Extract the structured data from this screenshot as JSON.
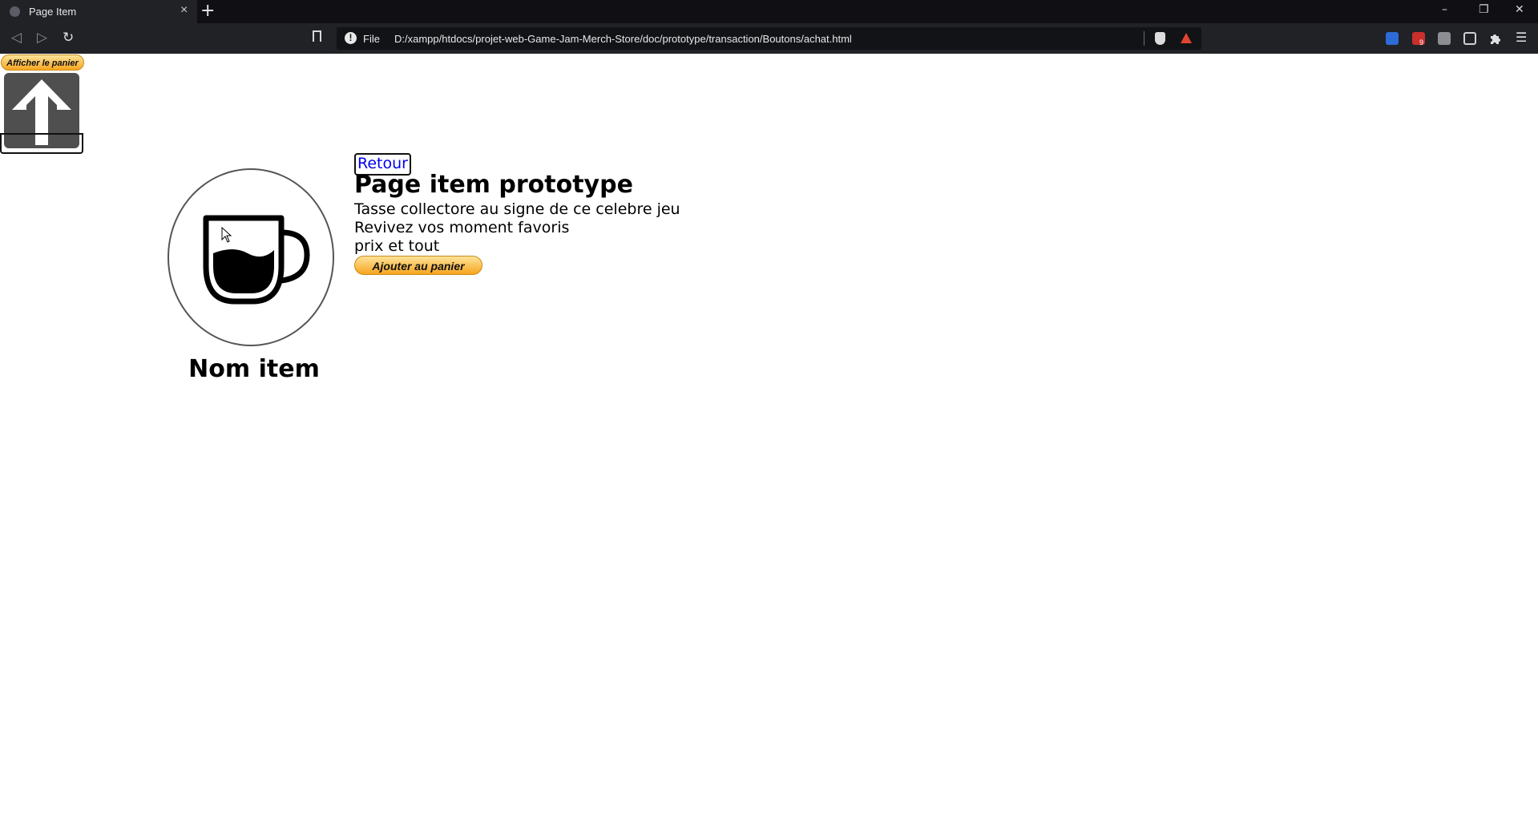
{
  "browser": {
    "tab_title": "Page Item",
    "tab_close": "×",
    "new_tab": "+",
    "url_scheme": "File",
    "url": "D:/xampp/htdocs/projet-web-Game-Jam-Merch-Store/doc/prototype/transaction/Boutons/achat.html",
    "window_controls": [
      "–",
      "❐",
      "✕"
    ],
    "extension_badge": "9"
  },
  "page": {
    "cart_button_label": "Afficher le panier",
    "back_link": "Retour",
    "title": "Page item prototype",
    "description_lines": [
      "Tasse collectore au signe de ce celebre jeu",
      "Revivez vos moment favoris",
      "prix et tout"
    ],
    "add_to_cart_label": "Ajouter au panier",
    "item_name": "Nom item",
    "item_icon": "coffee-cup-icon",
    "upload_icon": "arrow-up-icon"
  },
  "colors": {
    "button_gradient_top": "#fde39a",
    "button_gradient_bottom": "#f7a51f",
    "link": "#0000ee",
    "chrome_dark": "#202226"
  }
}
